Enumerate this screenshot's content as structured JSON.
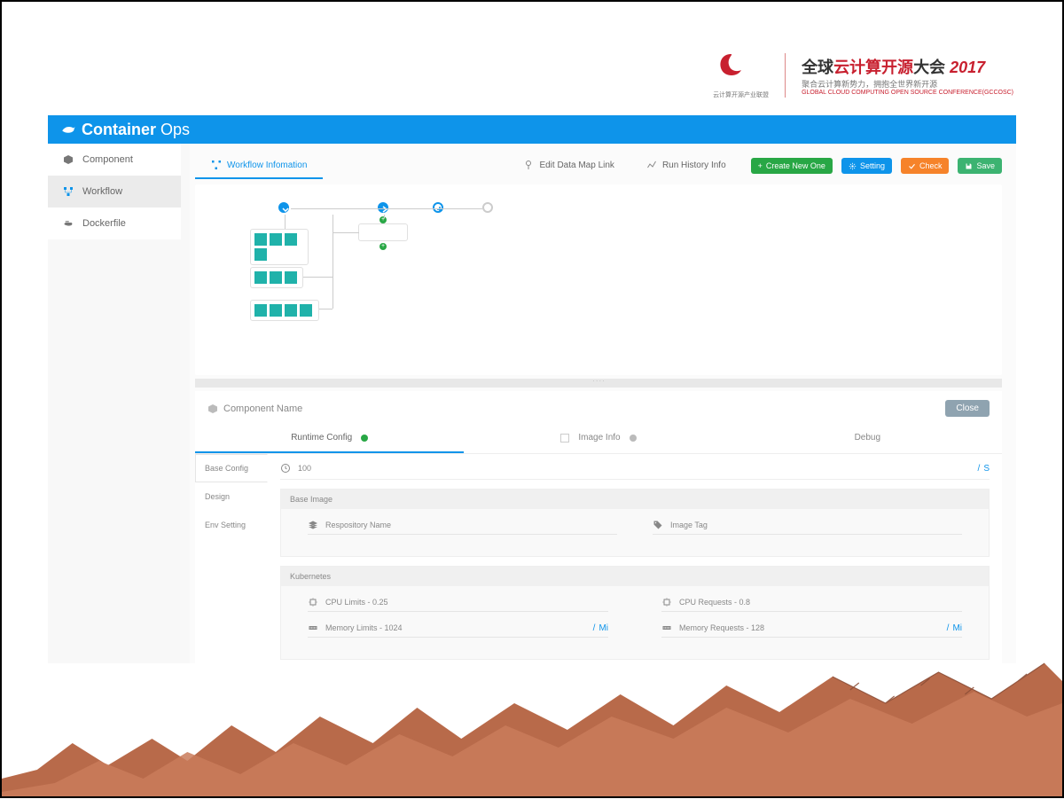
{
  "conference": {
    "title_cn_prefix": "全球",
    "title_cn_mid": "云计算开源",
    "title_cn_suffix": "大会",
    "year": "2017",
    "subtitle": "聚合云计算新势力，拥抱全世界新开源",
    "small": "GLOBAL CLOUD COMPUTING OPEN SOURCE CONFERENCE(GCCOSC)",
    "left_logo_caption": "云计算开源产业联盟"
  },
  "brand": {
    "name_bold": "Container",
    "name_thin": "Ops"
  },
  "sidebar": {
    "items": [
      {
        "label": "Component"
      },
      {
        "label": "Workflow"
      },
      {
        "label": "Dockerfile"
      }
    ]
  },
  "tabs": {
    "workflow_info": "Workflow  Infomation",
    "edit_data_map": "Edit Data Map Link",
    "run_history": "Run History Info"
  },
  "buttons": {
    "create": "Create New One",
    "setting": "Setting",
    "check": "Check",
    "save": "Save"
  },
  "component_panel": {
    "title": "Component Name",
    "close": "Close",
    "subtabs": {
      "runtime": "Runtime Config",
      "image": "Image Info",
      "debug": "Debug"
    },
    "vtabs": {
      "base": "Base Config",
      "design": "Design",
      "env": "Env Setting"
    },
    "timeout": {
      "value": "100",
      "unit": "S"
    },
    "base_image": {
      "section": "Base Image",
      "repo_label": "Respository Name",
      "tag_label": "Image Tag"
    },
    "kubernetes": {
      "section": "Kubernetes",
      "cpu_limits_label": "CPU Limits - 0.25",
      "cpu_requests_label": "CPU Requests - 0.8",
      "mem_limits_label": "Memory Limits - 1024",
      "mem_requests_label": "Memory Requests - 128",
      "mem_unit": "Mi"
    }
  }
}
